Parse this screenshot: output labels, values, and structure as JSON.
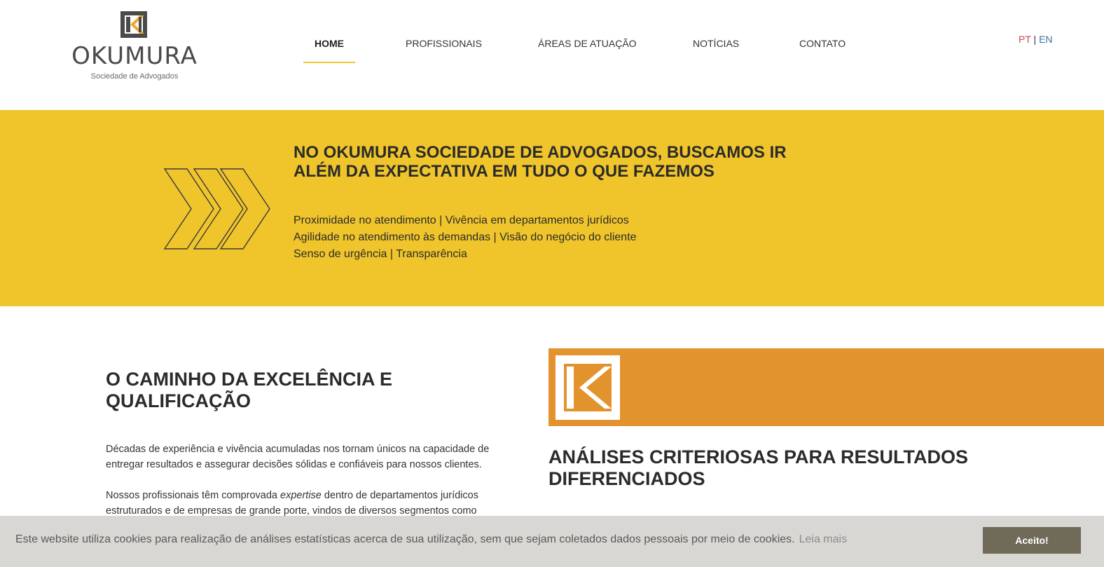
{
  "header": {
    "logo": {
      "wordmark": "OKUMURA",
      "subtitle": "Sociedade de Advogados"
    },
    "nav": [
      {
        "label": "HOME",
        "active": true
      },
      {
        "label": "PROFISSIONAIS",
        "active": false
      },
      {
        "label": "ÁREAS DE ATUAÇÃO",
        "active": false
      },
      {
        "label": "NOTÍCIAS",
        "active": false
      },
      {
        "label": "CONTATO",
        "active": false
      }
    ],
    "language": {
      "pt": "PT",
      "separator": "|",
      "en": "EN"
    }
  },
  "banner": {
    "title": "NO OKUMURA SOCIEDADE DE ADVOGADOS, BUSCAMOS IR ALÉM DA EXPECTATIVA EM TUDO O QUE FAZEMOS",
    "lines": [
      "Proximidade no atendimento | Vivência em departamentos jurídicos",
      "Agilidade no atendimento às demandas | Visão do negócio do cliente",
      "Senso de urgência | Transparência"
    ]
  },
  "left_section": {
    "heading": "O CAMINHO DA EXCELÊNCIA E QUALIFICAÇÃO",
    "paragraph1": "Décadas de experiência e vivência acumuladas nos tornam únicos na capacidade de entregar resultados e assegurar decisões sólidas e confiáveis para nossos clientes.",
    "paragraph2_before": "Nossos profissionais têm comprovada ",
    "paragraph2_em": "expertise",
    "paragraph2_after": " dentro de departamentos jurídicos estruturados e de empresas de grande porte, vindos de diversos segmentos como"
  },
  "right_section": {
    "heading": "ANÁLISES CRITERIOSAS PARA RESULTADOS DIFERENCIADOS"
  },
  "cookie": {
    "text": "Este website utiliza cookies para realização de análises estatísticas acerca de sua utilização, sem que sejam coletados dados pessoais por meio de cookies.",
    "more_label": "Leia mais",
    "accept_label": "Aceito!"
  },
  "colors": {
    "brand_yellow": "#f0c52b",
    "brand_orange": "#e2932d",
    "dark_text": "#2b2b2b",
    "cookie_bar": "#d8d7d3",
    "cookie_button": "#6f6b58",
    "lang_pt": "#c9484d",
    "lang_en": "#3e6fa8"
  },
  "icons": {
    "logo_mark": "okumura-k-logo-icon",
    "banner_arrows": "triple-chevron-icon",
    "orange_mark": "white-k-logo-icon"
  }
}
